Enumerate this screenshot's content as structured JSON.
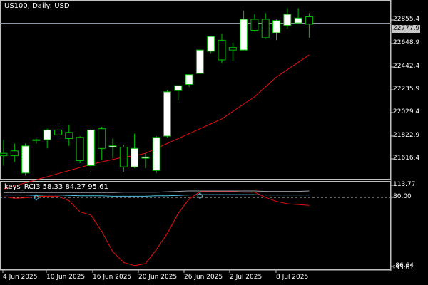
{
  "chart_header": {
    "symbol_label": "US100, Daily:  USD"
  },
  "indicator_header": {
    "label": "keys_RCI3 58.33 84.27 95.61"
  },
  "price_axis": {
    "ticks": [
      "22855.4",
      "22648.9",
      "22442.4",
      "22235.9",
      "22029.4",
      "21822.9",
      "21616.4"
    ],
    "current_price": "22777.9"
  },
  "indicator_axis": {
    "ticks": [
      "113.77",
      "80.00",
      "-95.61"
    ],
    "hidden_tick": "-86.64"
  },
  "time_axis": {
    "ticks": [
      "4 Jun 2025",
      "10 Jun 2025",
      "16 Jun 2025",
      "20 Jun 2025",
      "26 Jun 2025",
      "2 Jul 2025",
      "8 Jul 2025"
    ]
  },
  "colors": {
    "background": "#000000",
    "bull_candle_fill": "#ffffff",
    "bear_candle_fill": "#000000",
    "candle_outline": "#00c000",
    "moving_average": "#e81010",
    "rci_long": "#e81010",
    "rci_mid": "#4fc3e0",
    "rci_short": "#9aa0a8",
    "level_line": "#c0c0c0"
  },
  "chart_data": [
    {
      "type": "candlestick",
      "title": "US100, Daily:  USD",
      "x": [
        "3 Jun",
        "4 Jun",
        "5 Jun",
        "6 Jun",
        "9 Jun",
        "10 Jun",
        "11 Jun",
        "12 Jun",
        "13 Jun",
        "16 Jun",
        "17 Jun",
        "18 Jun",
        "19 Jun",
        "20 Jun",
        "23 Jun",
        "24 Jun",
        "25 Jun",
        "26 Jun",
        "27 Jun",
        "30 Jun",
        "1 Jul",
        "2 Jul",
        "3 Jul",
        "4 Jul",
        "7 Jul",
        "8 Jul",
        "9 Jul",
        "10 Jul",
        "11 Jul"
      ],
      "ohlc": [
        [
          21720,
          21830,
          21620,
          21700
        ],
        [
          21740,
          21800,
          21650,
          21700
        ],
        [
          21560,
          21800,
          21540,
          21780
        ],
        [
          21830,
          21840,
          21800,
          21830
        ],
        [
          21830,
          21920,
          21760,
          21910
        ],
        [
          21910,
          21985,
          21850,
          21870
        ],
        [
          21890,
          21950,
          21780,
          21840
        ],
        [
          21850,
          21860,
          21640,
          21660
        ],
        [
          21620,
          21920,
          21570,
          21910
        ],
        [
          21920,
          21935,
          21670,
          21760
        ],
        [
          21770,
          21840,
          21680,
          21780
        ],
        [
          21770,
          21790,
          21570,
          21610
        ],
        [
          21610,
          21880,
          21600,
          21760
        ],
        [
          21680,
          21720,
          21600,
          21690
        ],
        [
          21580,
          21860,
          21560,
          21850
        ],
        [
          21860,
          22230,
          21850,
          22220
        ],
        [
          22230,
          22240,
          22150,
          22270
        ],
        [
          22280,
          22350,
          22260,
          22360
        ],
        [
          22370,
          22430,
          22420,
          22560
        ],
        [
          22550,
          22640,
          22530,
          22670
        ],
        [
          22640,
          22690,
          22450,
          22480
        ],
        [
          22580,
          22620,
          22470,
          22560
        ],
        [
          22560,
          22880,
          22570,
          22810
        ],
        [
          22810,
          22850,
          22710,
          22720
        ],
        [
          22810,
          22860,
          22650,
          22660
        ],
        [
          22700,
          22810,
          22640,
          22800
        ],
        [
          22760,
          22900,
          22730,
          22850
        ],
        [
          22780,
          22900,
          22820,
          22820
        ],
        [
          22830,
          22860,
          22660,
          22770
        ]
      ],
      "moving_average": [
        21430,
        21455,
        21480,
        21505,
        21530,
        21555,
        21580,
        21605,
        21630,
        21650,
        21670,
        21690,
        21700,
        21720,
        21760,
        21800,
        21840,
        21880,
        21920,
        21960,
        22000,
        22060,
        22120,
        22180,
        22260,
        22340,
        22400,
        22460,
        22520
      ],
      "ylim": [
        21530,
        22920
      ]
    },
    {
      "type": "line",
      "title": "keys_RCI3 58.33 84.27 95.61",
      "x": [
        "3 Jun",
        "4 Jun",
        "5 Jun",
        "6 Jun",
        "9 Jun",
        "10 Jun",
        "11 Jun",
        "12 Jun",
        "13 Jun",
        "16 Jun",
        "17 Jun",
        "18 Jun",
        "19 Jun",
        "20 Jun",
        "23 Jun",
        "24 Jun",
        "25 Jun",
        "26 Jun",
        "27 Jun",
        "30 Jun",
        "1 Jul",
        "2 Jul",
        "3 Jul",
        "4 Jul",
        "7 Jul",
        "8 Jul",
        "9 Jul",
        "10 Jul",
        "11 Jul"
      ],
      "series": [
        {
          "values": [
            82,
            78,
            79,
            82,
            83,
            83,
            72,
            44,
            36,
            -5,
            -55,
            -82,
            -90,
            -85,
            -50,
            -10,
            40,
            76,
            94,
            95,
            95,
            95,
            93,
            93,
            80,
            70,
            64,
            62,
            60
          ]
        },
        {
          "values": [
            86,
            86,
            86,
            85,
            86,
            86,
            85,
            84,
            84,
            84,
            83,
            83,
            83,
            83,
            84,
            84,
            85,
            86,
            87,
            87,
            87,
            87,
            87,
            87,
            86,
            86,
            86,
            86,
            86
          ]
        },
        {
          "values": [
            92,
            92,
            92,
            92,
            92,
            92,
            92,
            92,
            92,
            92,
            92,
            93,
            93,
            93,
            93,
            94,
            95,
            96,
            96,
            96,
            96,
            96,
            96,
            96,
            95,
            95,
            95,
            95,
            96
          ]
        }
      ],
      "levels": [
        80
      ],
      "ylim": [
        -95.61,
        113.77
      ]
    }
  ]
}
